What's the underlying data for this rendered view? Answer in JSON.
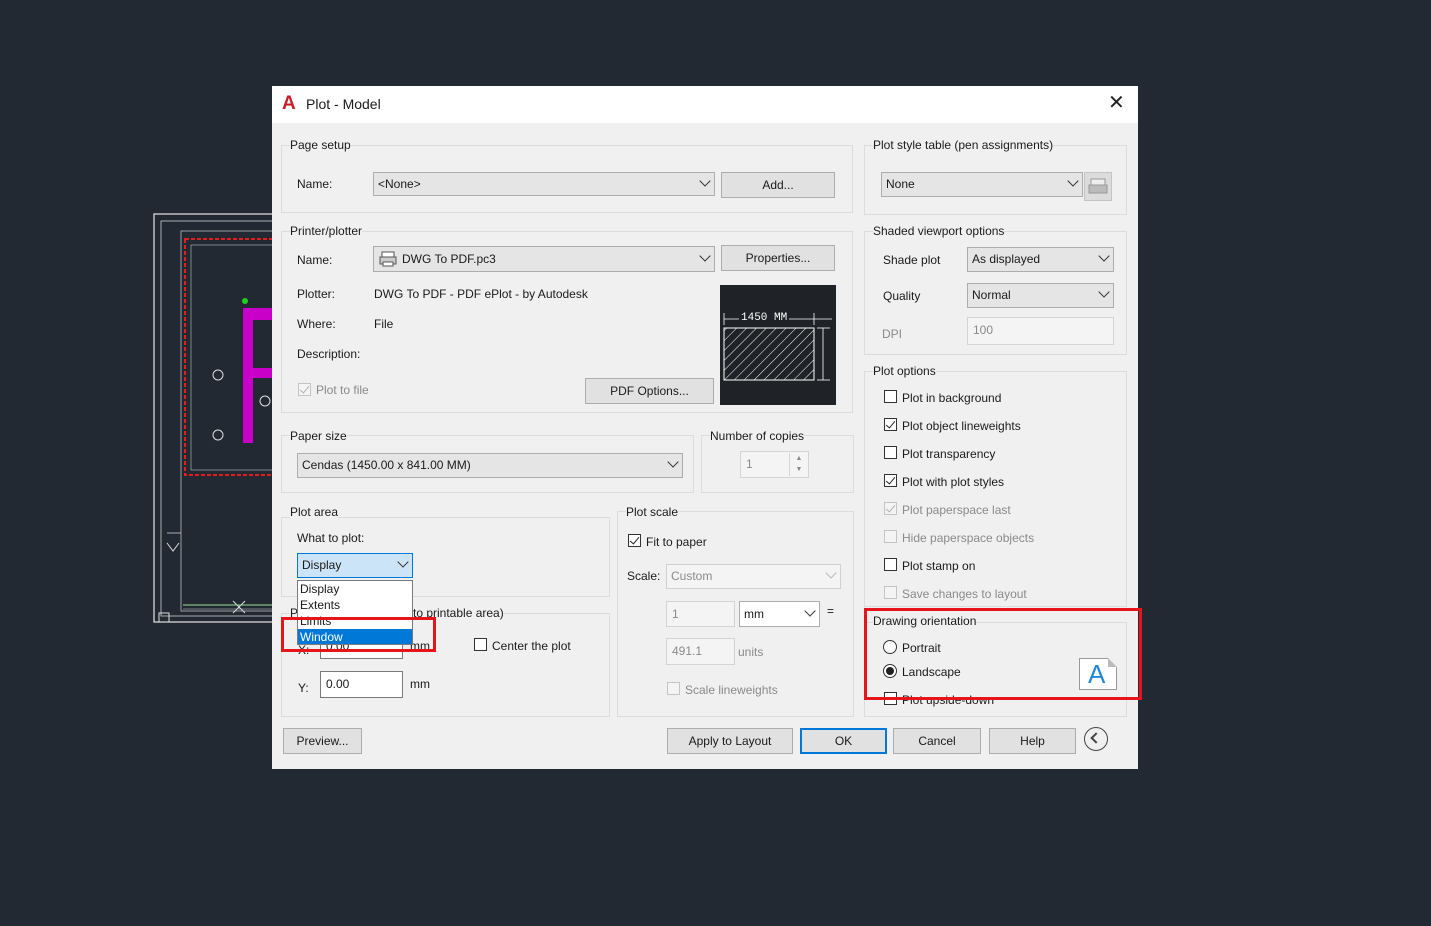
{
  "dialog": {
    "title": "Plot - Model",
    "close_glyph": "✕"
  },
  "page_setup": {
    "title": "Page setup",
    "name_label": "Name:",
    "name_value": "<None>",
    "add_button": "Add..."
  },
  "printer": {
    "title": "Printer/plotter",
    "name_label": "Name:",
    "name_value": "DWG To PDF.pc3",
    "properties_button": "Properties...",
    "plotter_label": "Plotter:",
    "plotter_value": "DWG To PDF - PDF ePlot - by Autodesk",
    "where_label": "Where:",
    "where_value": "File",
    "description_label": "Description:",
    "plot_to_file_label": "Plot to file",
    "plot_to_file_checked": true,
    "pdf_options_button": "PDF Options...",
    "preview_dimension": "1450  MM"
  },
  "paper_size": {
    "title": "Paper size",
    "value": "Cendas (1450.00 x 841.00 MM)"
  },
  "copies": {
    "title": "Number of copies",
    "value": "1"
  },
  "plot_area": {
    "title": "Plot area",
    "what_label": "What to plot:",
    "selected": "Display",
    "options": [
      "Display",
      "Extents",
      "Limits",
      "Window"
    ],
    "highlighted_option": "Window"
  },
  "plot_offset": {
    "title_prefix": "P",
    "title_suffix": "to printable area)",
    "x_label": "X:",
    "x_value": "0.00",
    "x_unit": "mm",
    "y_label": "Y:",
    "y_value": "0.00",
    "y_unit": "mm",
    "center_label": "Center the plot"
  },
  "plot_scale": {
    "title": "Plot scale",
    "fit_label": "Fit to paper",
    "fit_checked": true,
    "scale_label": "Scale:",
    "scale_value": "Custom",
    "numerator": "1",
    "unit_value": "mm",
    "equals": "=",
    "denominator": "491.1",
    "units_label": "units",
    "scale_lineweights_label": "Scale lineweights"
  },
  "plot_style_table": {
    "title": "Plot style table (pen assignments)",
    "value": "None"
  },
  "shaded_viewport": {
    "title": "Shaded viewport options",
    "shade_label": "Shade plot",
    "shade_value": "As displayed",
    "quality_label": "Quality",
    "quality_value": "Normal",
    "dpi_label": "DPI",
    "dpi_value": "100"
  },
  "plot_options": {
    "title": "Plot options",
    "items": [
      {
        "label": "Plot in background",
        "checked": false,
        "disabled": false
      },
      {
        "label": "Plot object lineweights",
        "checked": true,
        "disabled": false
      },
      {
        "label": "Plot transparency",
        "checked": false,
        "disabled": false
      },
      {
        "label": "Plot with plot styles",
        "checked": true,
        "disabled": false
      },
      {
        "label": "Plot paperspace last",
        "checked": true,
        "disabled": true
      },
      {
        "label": "Hide paperspace objects",
        "checked": false,
        "disabled": true
      },
      {
        "label": "Plot stamp on",
        "checked": false,
        "disabled": false
      },
      {
        "label": "Save changes to layout",
        "checked": false,
        "disabled": true
      }
    ]
  },
  "orientation": {
    "title": "Drawing orientation",
    "portrait_label": "Portrait",
    "landscape_label": "Landscape",
    "selected": "Landscape",
    "upside_down_label": "Plot upside-down",
    "icon_letter": "A"
  },
  "footer": {
    "preview_button": "Preview...",
    "apply_button": "Apply to Layout",
    "ok_button": "OK",
    "cancel_button": "Cancel",
    "help_button": "Help"
  },
  "colors": {
    "background": "#222933",
    "highlight": "#e8141c",
    "selection": "#0078d7",
    "magenta": "#c800c8"
  }
}
